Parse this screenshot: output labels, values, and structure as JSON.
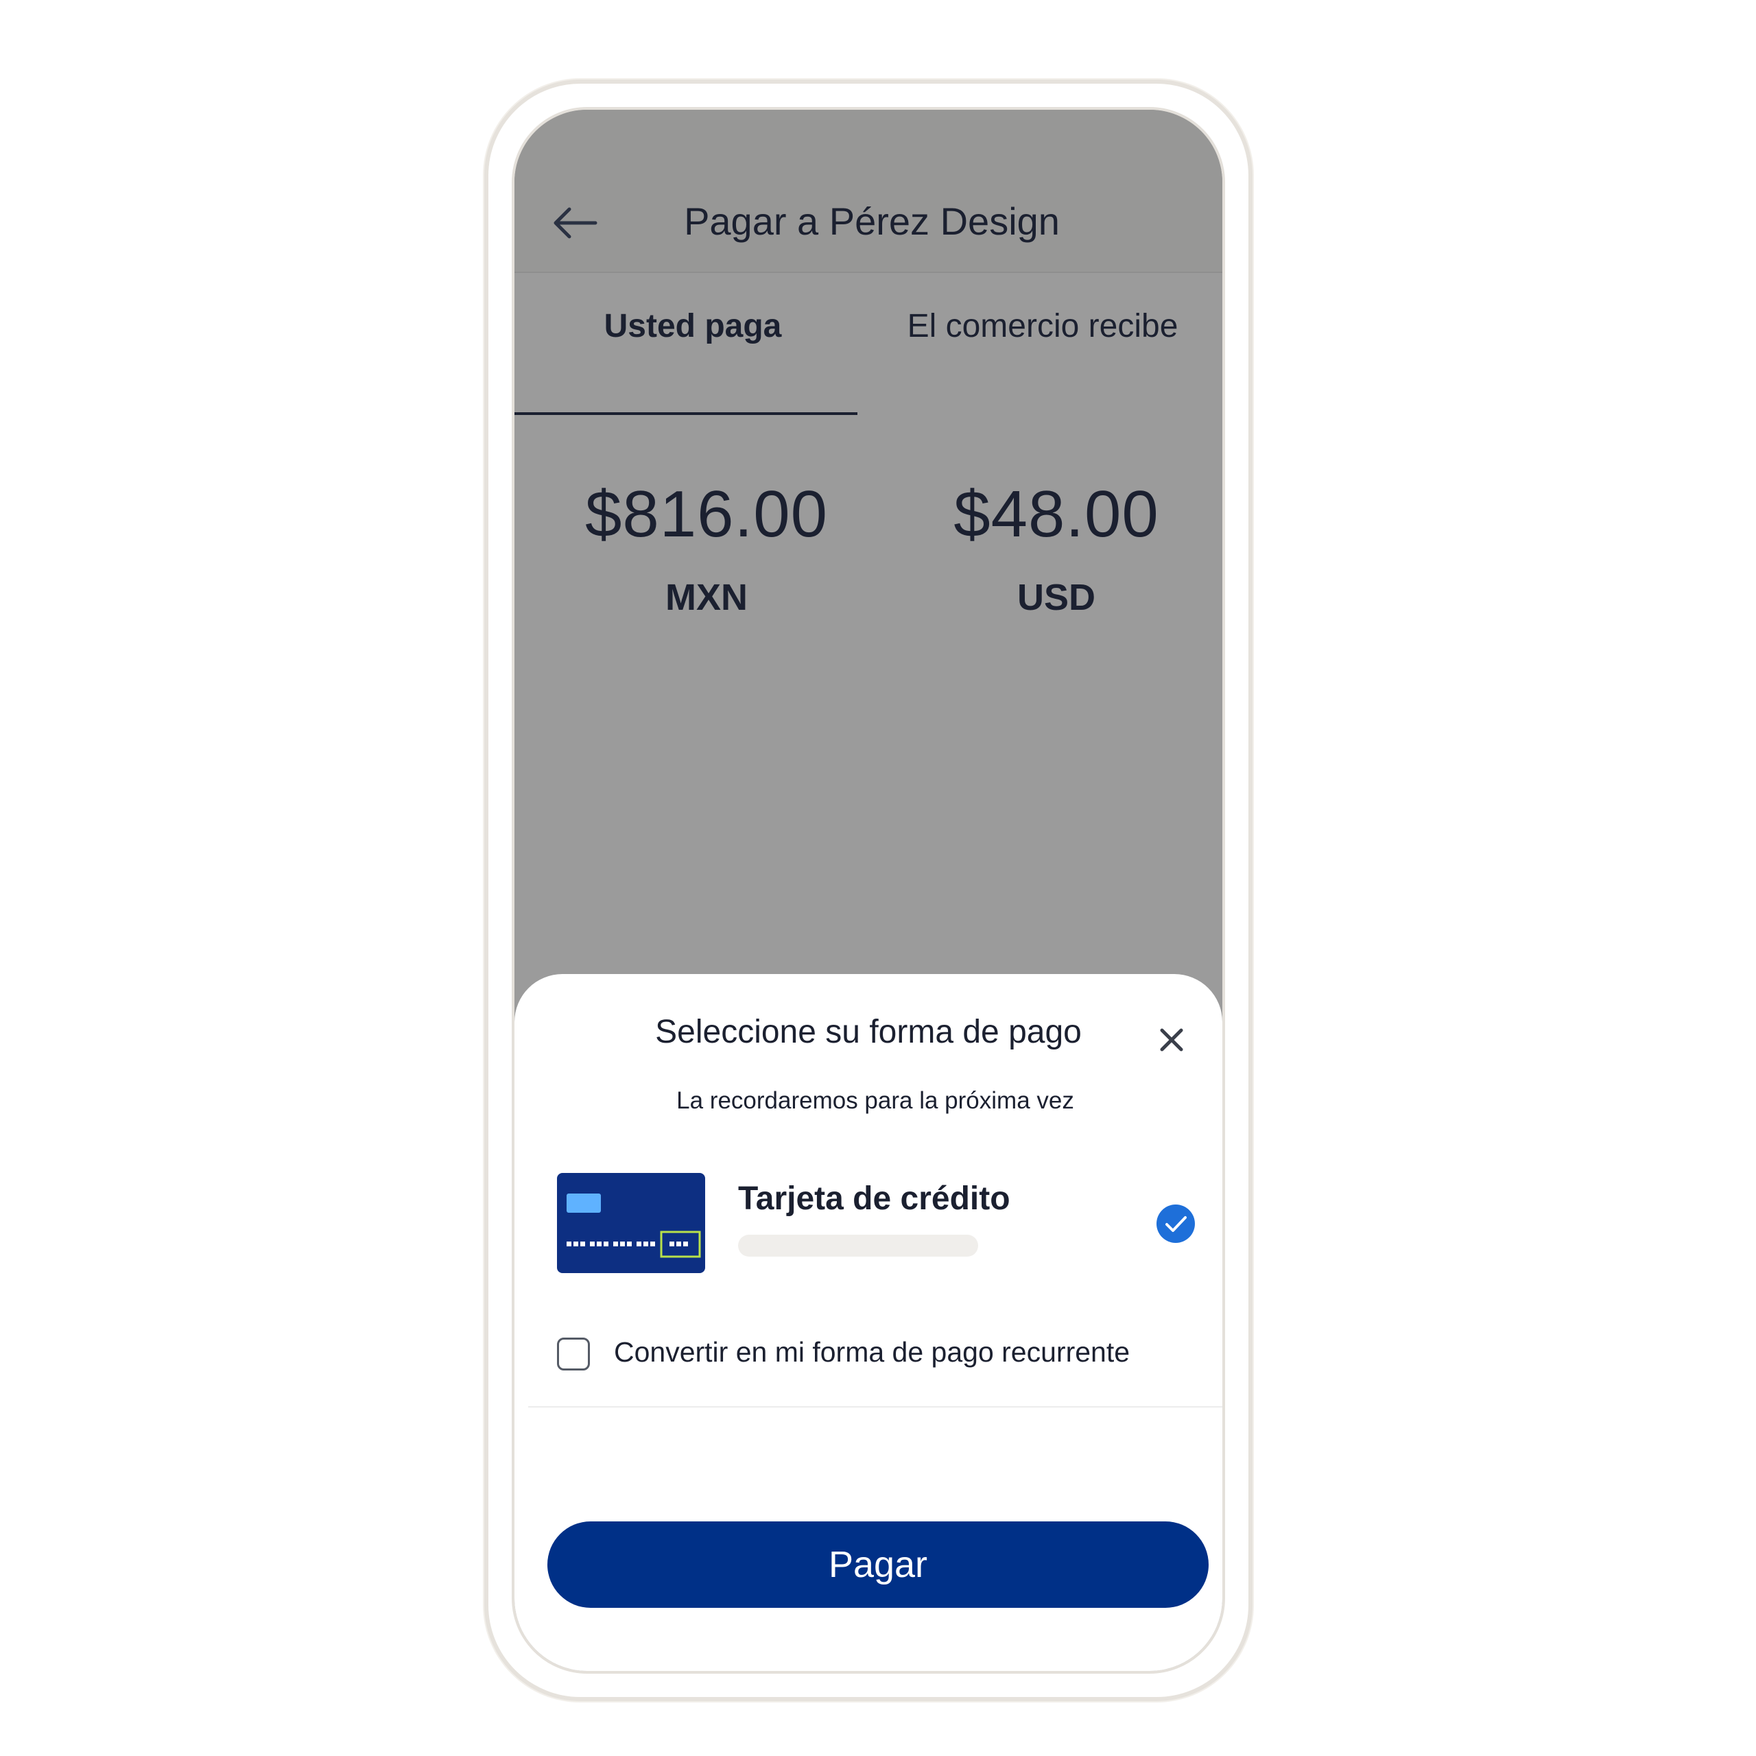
{
  "header": {
    "title": "Pagar a Pérez Design",
    "back_icon": "arrow-left-icon"
  },
  "tabs": [
    {
      "label": "Usted paga",
      "selected": true
    },
    {
      "label": "El comercio recibe",
      "selected": false
    }
  ],
  "amounts": {
    "pay": {
      "value": "$816.00",
      "currency": "MXN"
    },
    "receive": {
      "value": "$48.00",
      "currency": "USD"
    }
  },
  "sheet": {
    "title": "Seleccione su forma de pago",
    "subtitle": "La recordaremos para la próxima vez",
    "close_icon": "close-icon",
    "option": {
      "label": "Tarjeta de crédito",
      "icon": "credit-card-icon",
      "selected": true
    },
    "recurring_checkbox": {
      "label": "Convertir en mi forma de pago recurrente",
      "checked": false
    },
    "pay_button": "Pagar"
  },
  "colors": {
    "primary_button": "#003087",
    "check_blue": "#1e6fd9",
    "card_navy": "#0d2f82",
    "overlay_gray": "#9b9b9b"
  }
}
